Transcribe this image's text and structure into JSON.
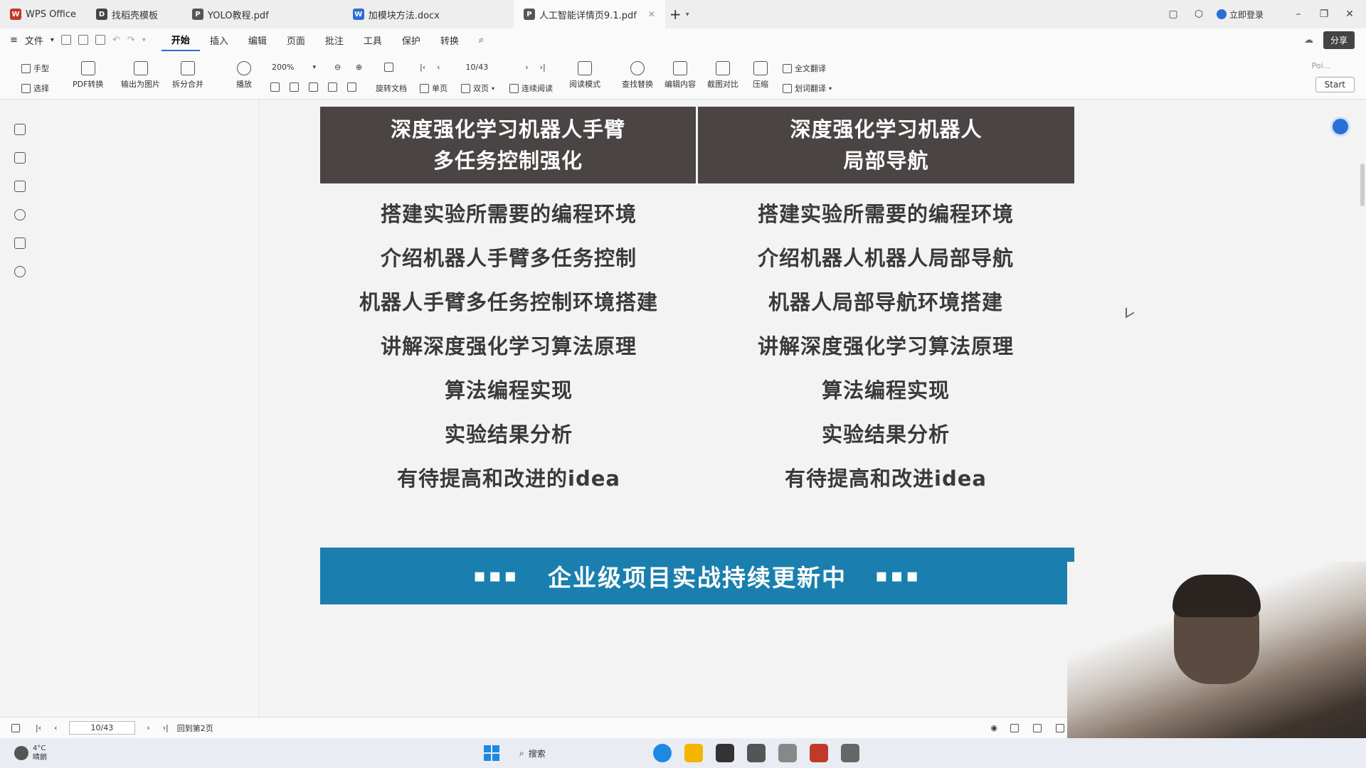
{
  "tabs": [
    {
      "label": "WPS Office",
      "icon": "wps-logo-icon",
      "color": "#c0392b"
    },
    {
      "label": "找稻壳模板",
      "icon": "template-icon",
      "color": "#444444"
    },
    {
      "label": "YOLO教程.pdf",
      "icon": "pdf-icon",
      "color": "#555555"
    },
    {
      "label": "加模块方法.docx",
      "icon": "word-icon",
      "color": "#2b6fd6"
    },
    {
      "label": "人工智能详情页9.1.pdf",
      "icon": "pdf-icon",
      "color": "#555555",
      "active": true
    }
  ],
  "account": "立即登录",
  "menu": {
    "file": "文件",
    "items": [
      "开始",
      "插入",
      "编辑",
      "页面",
      "批注",
      "工具",
      "保护",
      "转换"
    ],
    "active": "开始",
    "share": "分享"
  },
  "ribbon": {
    "hand": "手型",
    "select": "选择",
    "pdf_convert": "PDF转换",
    "export_image": "输出为图片",
    "split_merge": "拆分合并",
    "play": "播放",
    "zoom": "200%",
    "page": "10/43",
    "rotate": "旋转文档",
    "single": "单页",
    "double": "双页",
    "continuous": "连续阅读",
    "read_mode": "阅读模式",
    "find_replace": "查找替换",
    "edit_content": "编辑内容",
    "compare": "截图对比",
    "compress": "压缩",
    "translate_full": "全文翻译",
    "translate_word": "划词翻译",
    "poi": "Poi...",
    "start": "Start"
  },
  "document": {
    "left_header": [
      "深度强化学习机器人手臂",
      "多任务控制强化"
    ],
    "right_header": [
      "深度强化学习机器人",
      "局部导航"
    ],
    "left_items": [
      "搭建实验所需要的编程环境",
      "介绍机器人手臂多任务控制",
      "机器人手臂多任务控制环境搭建",
      "讲解深度强化学习算法原理",
      "算法编程实现",
      "实验结果分析",
      "有待提高和改进的idea"
    ],
    "right_items": [
      "搭建实验所需要的编程环境",
      "介绍机器人机器人局部导航",
      "机器人局部导航环境搭建",
      "讲解深度强化学习算法原理",
      "算法编程实现",
      "实验结果分析",
      "有待提高和改进idea"
    ],
    "banner": "企业级项目实战持续更新中",
    "banner_dots": "▪▪▪",
    "header_color": "#4a4444",
    "banner_color": "#1a7faf"
  },
  "statusbar": {
    "page": "10/43",
    "goto": "回到第2页"
  },
  "taskbar": {
    "temperature": "4°C",
    "weather": "晴朗",
    "search": "搜索"
  }
}
